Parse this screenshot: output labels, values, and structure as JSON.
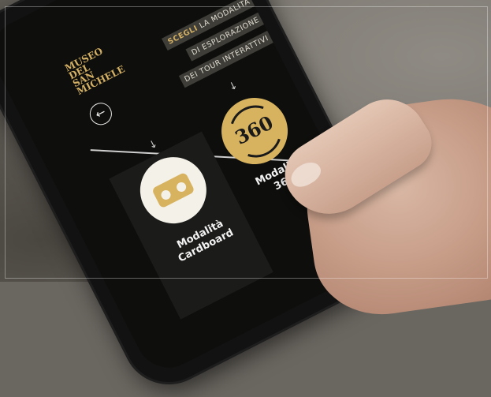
{
  "museum": {
    "logo_lines": [
      "MUSEO",
      "DEL",
      "SAN",
      "MICHELE"
    ]
  },
  "back_icon": "arrow-left-icon",
  "intro": {
    "highlight": "SCEGLI",
    "line1_rest": "LA MODALITÀ",
    "line2": "DI ESPLORAZIONE",
    "line3": "DEI TOUR INTERATTIVI"
  },
  "options": [
    {
      "icon": "vr-cardboard-icon",
      "label_line1": "Modalità",
      "label_line2": "Cardboard"
    },
    {
      "icon": "360-view-icon",
      "icon_text": "360",
      "label_line1": "Modalità",
      "label_line2": "360"
    }
  ],
  "colors": {
    "accent_gold": "#d8b35f",
    "screen_background": "#0e0e0c"
  }
}
